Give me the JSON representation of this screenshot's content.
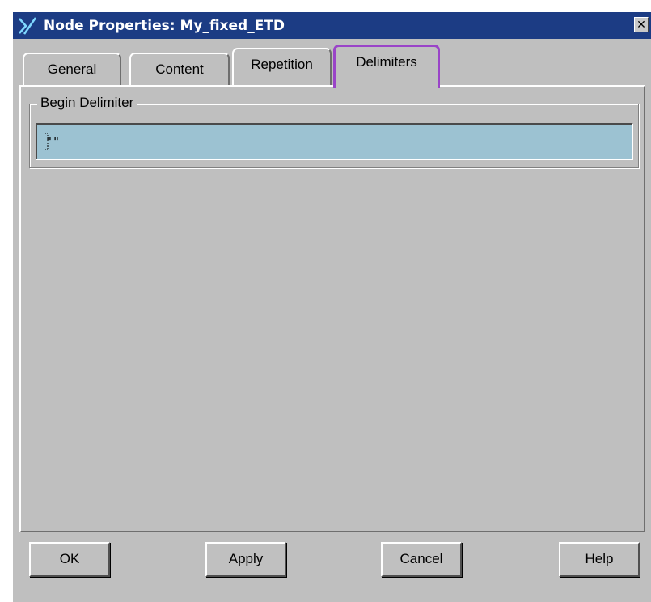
{
  "window": {
    "title": "Node Properties: My_fixed_ETD",
    "close_glyph": "✕",
    "title_bar_color": "#1c3c84",
    "icon": "x-logo-icon"
  },
  "tabs": [
    {
      "label": "General",
      "selected": false
    },
    {
      "label": "Content",
      "selected": false
    },
    {
      "label": "Repetition",
      "selected": false
    },
    {
      "label": "Delimiters",
      "selected": true
    }
  ],
  "delimiters": {
    "begin_group_label": "Begin Delimiter",
    "begin_value": "\"\"",
    "field_color": "#9cc2d2"
  },
  "buttons": {
    "ok": "OK",
    "apply": "Apply",
    "cancel": "Cancel",
    "help": "Help"
  },
  "colors": {
    "selected_tab_outline": "#9a44c8",
    "dialog_background": "#bfbfbf"
  }
}
